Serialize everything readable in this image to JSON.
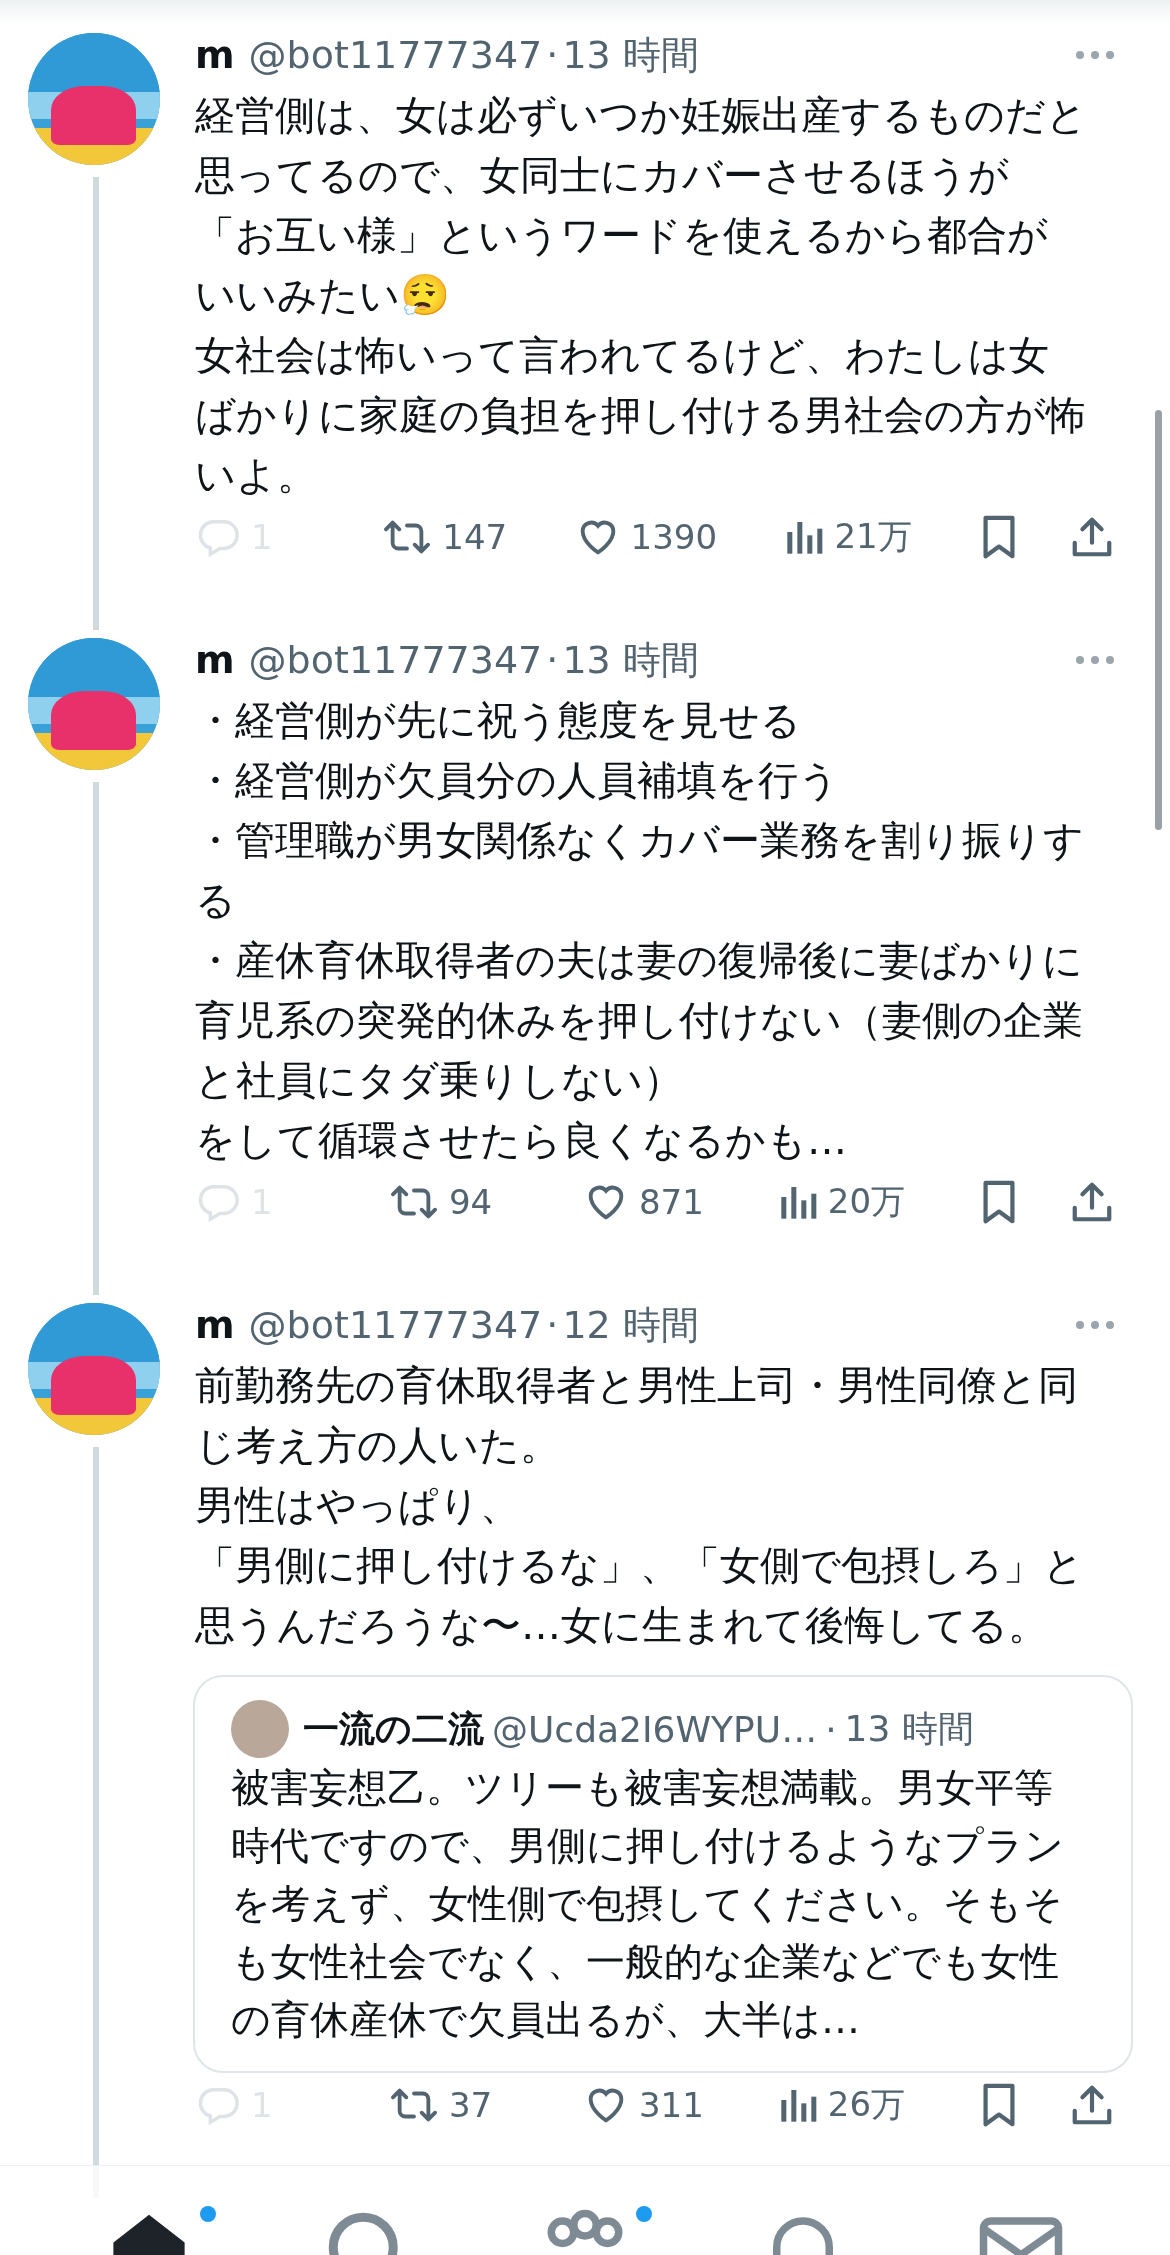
{
  "tweets": [
    {
      "name": "m",
      "handle": "@bot11777347",
      "separator": "·",
      "time": "13 時間",
      "paragraphs": [
        "経営側は、女は必ずいつか妊娠出産するものだと思ってるので、女同士にカバーさせるほうが「お互い様」というワードを使えるから都合がいいみたい😮‍💨",
        "女社会は怖いって言われてるけど、わたしは女ばかりに家庭の負担を押し付ける男社会の方が怖いよ。"
      ],
      "replies": "1",
      "retweets": "147",
      "likes": "1390",
      "views": "21万"
    },
    {
      "name": "m",
      "handle": "@bot11777347",
      "separator": "·",
      "time": "13 時間",
      "paragraphs": [
        "・経営側が先に祝う態度を見せる",
        "・経営側が欠員分の人員補填を行う",
        "・管理職が男女関係なくカバー業務を割り振りする",
        "・産休育休取得者の夫は妻の復帰後に妻ばかりに育児系の突発的休みを押し付けない（妻側の企業と社員にタダ乗りしない）",
        "をして循環させたら良くなるかも…"
      ],
      "replies": "1",
      "retweets": "94",
      "likes": "871",
      "views": "20万"
    },
    {
      "name": "m",
      "handle": "@bot11777347",
      "separator": "·",
      "time": "12 時間",
      "paragraphs": [
        "前勤務先の育休取得者と男性上司・男性同僚と同じ考え方の人いた。",
        "男性はやっぱり、",
        "「男側に押し付けるな」、「女側で包摂しろ」と思うんだろうな〜…女に生まれて後悔してる。"
      ],
      "quote": {
        "name": "一流の二流",
        "handle": "@Ucda2I6WYPU…",
        "separator": "·",
        "time": "13 時間",
        "text": "被害妄想乙。ツリーも被害妄想満載。男女平等時代ですので、男側に押し付けるようなプランを考えず、女性側で包摂してください。そもそも女性社会でなく、一般的な企業などでも女性の育休産休で欠員出るが、大半は…"
      },
      "replies": "1",
      "retweets": "37",
      "likes": "311",
      "views": "26万"
    }
  ],
  "tab_bar": [
    {
      "selected": true,
      "badge": true
    },
    {
      "selected": false,
      "badge": false
    },
    {
      "selected": false,
      "badge": true
    },
    {
      "selected": false,
      "badge": false
    },
    {
      "selected": false,
      "badge": false
    }
  ]
}
